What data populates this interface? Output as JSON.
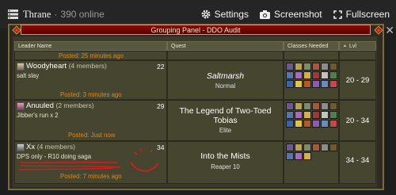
{
  "topbar": {
    "server": "Thrane",
    "separator": "·",
    "online": "390 online",
    "settings_label": "Settings",
    "screenshot_label": "Screenshot",
    "fullscreen_label": "Fullscreen"
  },
  "panel": {
    "title": "Grouping Panel - DDO Audit",
    "headers": {
      "leader": "Leader Name",
      "quest": "Quest",
      "classes": "Classes Needed",
      "level": "Lvl"
    }
  },
  "groups": [
    {
      "leader": "",
      "members": "",
      "level": "",
      "comment": "",
      "posted": "Posted: 25 minutes ago",
      "quest": "",
      "difficulty": "",
      "range": ""
    },
    {
      "leader": "Woodyheart",
      "members": "(4 members)",
      "level": "22",
      "comment": "salt slay",
      "posted": "Posted: 3 minutes ago",
      "quest": "Saltmarsh",
      "difficulty": "Normal",
      "range": "20 - 29"
    },
    {
      "leader": "Anuuled",
      "members": "(2 members)",
      "level": "29",
      "comment": "Jibber's run x 2",
      "posted": "Posted: Just now",
      "quest": "The Legend of Two-Toed Tobias",
      "difficulty": "Elite",
      "range": "20 - 34"
    },
    {
      "leader": "Xx",
      "members": "(4 members)",
      "level": "34",
      "comment": "DPS only - R10 doing saga",
      "posted": "Posted: 7 minutes ago",
      "quest": "Into the Mists",
      "difficulty": "Reaper 10",
      "range": "34 - 34"
    }
  ],
  "colors": {
    "accent_red": "#7a0404",
    "gold": "#c9a24b",
    "posted_orange": "#d48a2e"
  }
}
